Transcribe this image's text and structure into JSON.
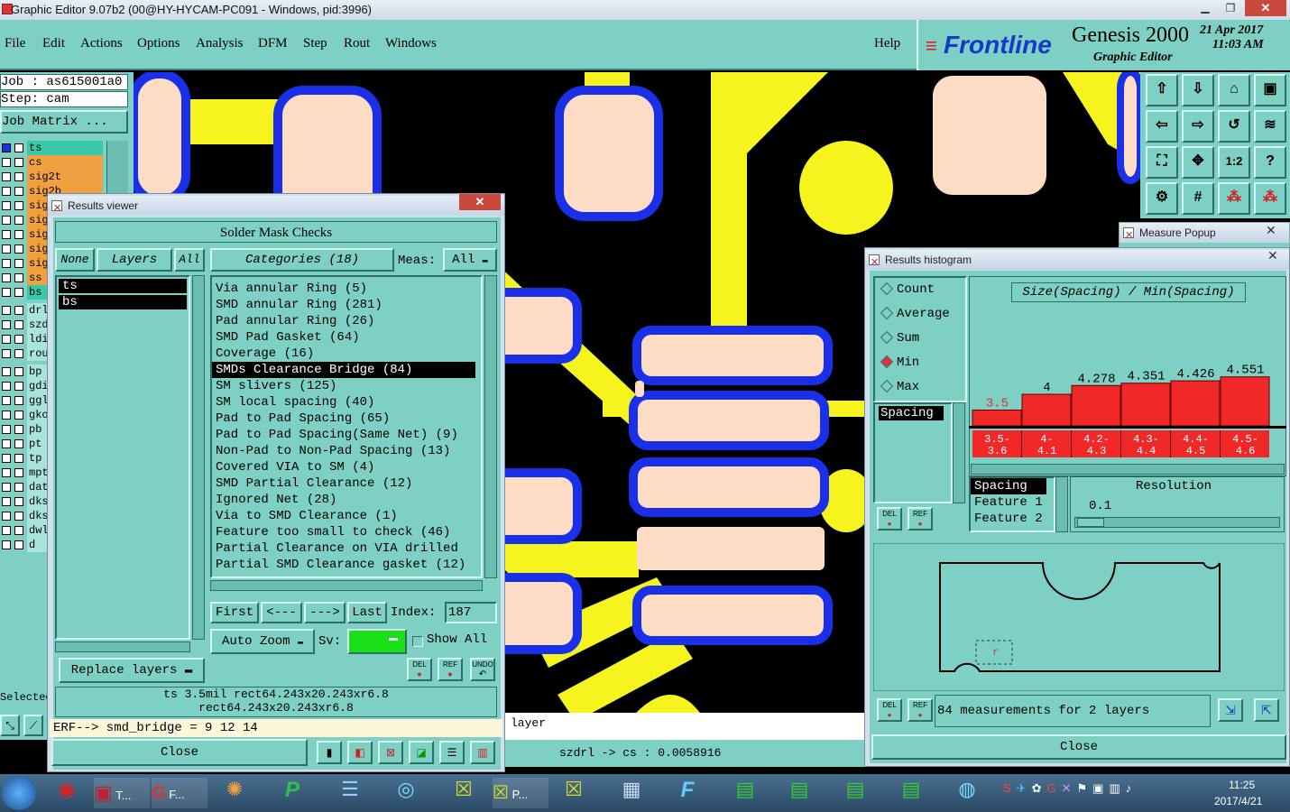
{
  "window": {
    "title": "Graphic Editor 9.07b2 (00@HY-HYCAM-PC091 - Windows, pid:3996)",
    "controls": [
      "minimize",
      "restore",
      "close"
    ]
  },
  "menubar": {
    "items": [
      "File",
      "Edit",
      "Actions",
      "Options",
      "Analysis",
      "DFM",
      "Step",
      "Rout",
      "Windows"
    ],
    "help": "Help"
  },
  "brand": {
    "logo": "Frontline",
    "product": "Genesis 2000",
    "subtitle": "Graphic Editor",
    "date": "21 Apr 2017",
    "time": "11:03 AM"
  },
  "job": {
    "job_label": "Job : as615001a0",
    "step_label": "Step: cam",
    "matrix_button": "Job Matrix ...",
    "selected_label": "Selected"
  },
  "layers": [
    {
      "name": "ts",
      "color": "#38c8a8",
      "edge": "#a0e0d0"
    },
    {
      "name": "cs",
      "color": "#f0a040",
      "edge": ""
    },
    {
      "name": "sig2t",
      "color": "#f0a040",
      "edge": ""
    },
    {
      "name": "sig2b",
      "color": "#f0a040",
      "edge": ""
    },
    {
      "name": "sig",
      "color": "#f0a040",
      "edge": ""
    },
    {
      "name": "sig",
      "color": "#f0a040",
      "edge": ""
    },
    {
      "name": "sig",
      "color": "#f0a040",
      "edge": ""
    },
    {
      "name": "sig",
      "color": "#f0a040",
      "edge": ""
    },
    {
      "name": "sig",
      "color": "#f0a040",
      "edge": ""
    },
    {
      "name": "ss",
      "color": "#f0a040",
      "edge": ""
    },
    {
      "name": "bs",
      "color": "#38c8a8",
      "edge": ""
    },
    {
      "name": "drl",
      "color": "#a8e4dc",
      "edge": ""
    },
    {
      "name": "szd",
      "color": "#a8e4dc",
      "edge": ""
    },
    {
      "name": "ldi",
      "color": "#a8e4dc",
      "edge": ""
    },
    {
      "name": "rou",
      "color": "#a8e4dc",
      "edge": ""
    },
    {
      "name": "bp",
      "color": "#a8e4dc",
      "edge": ""
    },
    {
      "name": "gdi",
      "color": "#a8e4dc",
      "edge": ""
    },
    {
      "name": "ggl",
      "color": "#a8e4dc",
      "edge": ""
    },
    {
      "name": "gko",
      "color": "#a8e4dc",
      "edge": ""
    },
    {
      "name": "pb",
      "color": "#a8e4dc",
      "edge": ""
    },
    {
      "name": "pt",
      "color": "#a8e4dc",
      "edge": ""
    },
    {
      "name": "tp",
      "color": "#a8e4dc",
      "edge": ""
    },
    {
      "name": "mpt",
      "color": "#a8e4dc",
      "edge": ""
    },
    {
      "name": "dat",
      "color": "#a8e4dc",
      "edge": ""
    },
    {
      "name": "dks",
      "color": "#a8e4dc",
      "edge": ""
    },
    {
      "name": "dks",
      "color": "#a8e4dc",
      "edge": ""
    },
    {
      "name": "dwl",
      "color": "#a8e4dc",
      "edge": ""
    },
    {
      "name": "d",
      "color": "#a8e4dc",
      "edge": ""
    }
  ],
  "results_viewer": {
    "title": "Results viewer",
    "header": "Solder Mask Checks",
    "none_btn": "None",
    "layers_btn": "Layers",
    "all_btn": "All",
    "layer_list": [
      "ts",
      "bs"
    ],
    "categories_btn": "Categories (18)",
    "meas_label": "Meas:",
    "meas_value": "All",
    "categories": [
      "Via annular Ring (5)",
      "SMD annular Ring (281)",
      "Pad annular Ring (26)",
      "SMD Pad Gasket (64)",
      "Coverage (16)",
      "SMDs Clearance Bridge (84)",
      "SM slivers (125)",
      "SM local spacing (40)",
      "Pad to Pad Spacing (65)",
      "Pad to Pad Spacing(Same Net) (9)",
      "Non-Pad to Non-Pad Spacing (13)",
      "Covered VIA to SM (4)",
      "SMD Partial Clearance (12)",
      "Ignored Net (28)",
      "Via to SMD Clearance (1)",
      "Feature too small to check (46)",
      "Partial Clearance on VIA drilled",
      "Partial SMD Clearance gasket (12)"
    ],
    "selected_category": 5,
    "first_btn": "First",
    "prev_btn": "<---",
    "next_btn": "--->",
    "last_btn": "Last",
    "index_label": "Index:",
    "index_value": "187",
    "autozoom": "Auto Zoom",
    "sv_label": "Sv:",
    "show_all": "Show All",
    "replace_layers": "Replace layers",
    "info_line1": "ts 3.5mil  rect64.243x20.243xr6.8",
    "info_line2": "rect64.243x20.243xr6.8",
    "erf_line": "ERF--> smd_bridge = 9 12 14",
    "close": "Close",
    "small_btns": [
      "DEL",
      "REF",
      "UNDO"
    ]
  },
  "bottom_status": {
    "layer_text": "layer",
    "measure_text": "szdrl -> cs : 0.0058916"
  },
  "measure_popup": {
    "title": "Measure Popup"
  },
  "histogram": {
    "title": "Results histogram",
    "modes": [
      "Count",
      "Average",
      "Sum",
      "Min",
      "Max"
    ],
    "selected_mode": "Min",
    "chart_title": "Size(Spacing) / Min(Spacing)",
    "list_items": [
      "Spacing"
    ],
    "field_list": [
      "Spacing",
      "Feature 1",
      "Feature 2"
    ],
    "resolution_label": "Resolution",
    "resolution_value": "0.1",
    "summary": "84 measurements for 2 layers",
    "close": "Close",
    "small_btns": [
      "DEL",
      "REF"
    ]
  },
  "chart_data": {
    "type": "bar",
    "title": "Size(Spacing) / Min(Spacing)",
    "categories": [
      "3.5-3.6",
      "4-4.1",
      "4.2-4.3",
      "4.3-4.4",
      "4.4-4.5",
      "4.5-4.6"
    ],
    "category_lines": [
      [
        "3.5-",
        "3.6"
      ],
      [
        "4-",
        "4.1"
      ],
      [
        "4.2-",
        "4.3"
      ],
      [
        "4.3-",
        "4.4"
      ],
      [
        "4.4-",
        "4.5"
      ],
      [
        "4.5-",
        "4.6"
      ]
    ],
    "values": [
      3.5,
      4,
      4.278,
      4.351,
      4.426,
      4.551
    ],
    "value_labels": [
      "3.5",
      "4",
      "4.278",
      "4.351",
      "4.426",
      "4.551"
    ],
    "first_label_color": "#e03030",
    "bar_color": "#f02828"
  },
  "taskbar": {
    "time": "11:25",
    "date": "2017/4/21",
    "item_label": "T...",
    "f_label": "F...",
    "p_label": "P..."
  }
}
